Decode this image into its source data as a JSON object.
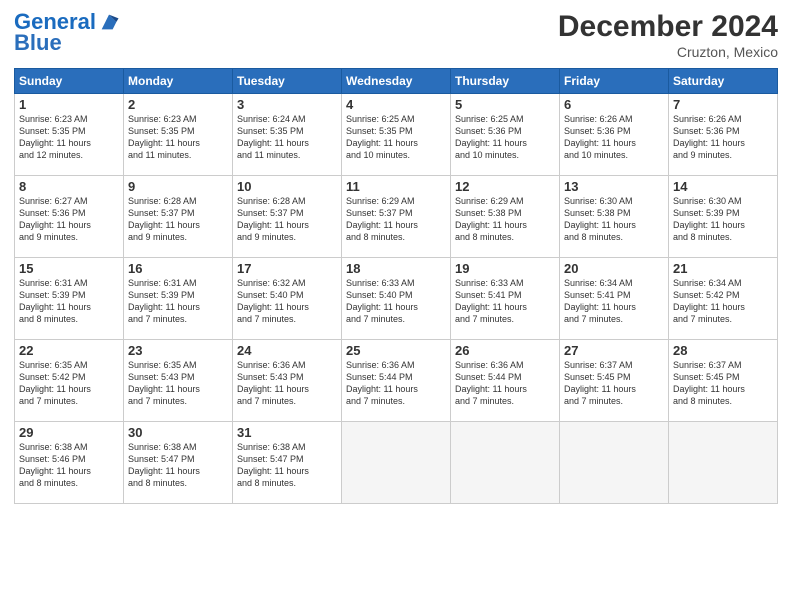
{
  "header": {
    "logo_line1": "General",
    "logo_line2": "Blue",
    "month": "December 2024",
    "location": "Cruzton, Mexico"
  },
  "weekdays": [
    "Sunday",
    "Monday",
    "Tuesday",
    "Wednesday",
    "Thursday",
    "Friday",
    "Saturday"
  ],
  "weeks": [
    [
      {
        "day": "1",
        "info": "Sunrise: 6:23 AM\nSunset: 5:35 PM\nDaylight: 11 hours\nand 12 minutes."
      },
      {
        "day": "2",
        "info": "Sunrise: 6:23 AM\nSunset: 5:35 PM\nDaylight: 11 hours\nand 11 minutes."
      },
      {
        "day": "3",
        "info": "Sunrise: 6:24 AM\nSunset: 5:35 PM\nDaylight: 11 hours\nand 11 minutes."
      },
      {
        "day": "4",
        "info": "Sunrise: 6:25 AM\nSunset: 5:35 PM\nDaylight: 11 hours\nand 10 minutes."
      },
      {
        "day": "5",
        "info": "Sunrise: 6:25 AM\nSunset: 5:36 PM\nDaylight: 11 hours\nand 10 minutes."
      },
      {
        "day": "6",
        "info": "Sunrise: 6:26 AM\nSunset: 5:36 PM\nDaylight: 11 hours\nand 10 minutes."
      },
      {
        "day": "7",
        "info": "Sunrise: 6:26 AM\nSunset: 5:36 PM\nDaylight: 11 hours\nand 9 minutes."
      }
    ],
    [
      {
        "day": "8",
        "info": "Sunrise: 6:27 AM\nSunset: 5:36 PM\nDaylight: 11 hours\nand 9 minutes."
      },
      {
        "day": "9",
        "info": "Sunrise: 6:28 AM\nSunset: 5:37 PM\nDaylight: 11 hours\nand 9 minutes."
      },
      {
        "day": "10",
        "info": "Sunrise: 6:28 AM\nSunset: 5:37 PM\nDaylight: 11 hours\nand 9 minutes."
      },
      {
        "day": "11",
        "info": "Sunrise: 6:29 AM\nSunset: 5:37 PM\nDaylight: 11 hours\nand 8 minutes."
      },
      {
        "day": "12",
        "info": "Sunrise: 6:29 AM\nSunset: 5:38 PM\nDaylight: 11 hours\nand 8 minutes."
      },
      {
        "day": "13",
        "info": "Sunrise: 6:30 AM\nSunset: 5:38 PM\nDaylight: 11 hours\nand 8 minutes."
      },
      {
        "day": "14",
        "info": "Sunrise: 6:30 AM\nSunset: 5:39 PM\nDaylight: 11 hours\nand 8 minutes."
      }
    ],
    [
      {
        "day": "15",
        "info": "Sunrise: 6:31 AM\nSunset: 5:39 PM\nDaylight: 11 hours\nand 8 minutes."
      },
      {
        "day": "16",
        "info": "Sunrise: 6:31 AM\nSunset: 5:39 PM\nDaylight: 11 hours\nand 7 minutes."
      },
      {
        "day": "17",
        "info": "Sunrise: 6:32 AM\nSunset: 5:40 PM\nDaylight: 11 hours\nand 7 minutes."
      },
      {
        "day": "18",
        "info": "Sunrise: 6:33 AM\nSunset: 5:40 PM\nDaylight: 11 hours\nand 7 minutes."
      },
      {
        "day": "19",
        "info": "Sunrise: 6:33 AM\nSunset: 5:41 PM\nDaylight: 11 hours\nand 7 minutes."
      },
      {
        "day": "20",
        "info": "Sunrise: 6:34 AM\nSunset: 5:41 PM\nDaylight: 11 hours\nand 7 minutes."
      },
      {
        "day": "21",
        "info": "Sunrise: 6:34 AM\nSunset: 5:42 PM\nDaylight: 11 hours\nand 7 minutes."
      }
    ],
    [
      {
        "day": "22",
        "info": "Sunrise: 6:35 AM\nSunset: 5:42 PM\nDaylight: 11 hours\nand 7 minutes."
      },
      {
        "day": "23",
        "info": "Sunrise: 6:35 AM\nSunset: 5:43 PM\nDaylight: 11 hours\nand 7 minutes."
      },
      {
        "day": "24",
        "info": "Sunrise: 6:36 AM\nSunset: 5:43 PM\nDaylight: 11 hours\nand 7 minutes."
      },
      {
        "day": "25",
        "info": "Sunrise: 6:36 AM\nSunset: 5:44 PM\nDaylight: 11 hours\nand 7 minutes."
      },
      {
        "day": "26",
        "info": "Sunrise: 6:36 AM\nSunset: 5:44 PM\nDaylight: 11 hours\nand 7 minutes."
      },
      {
        "day": "27",
        "info": "Sunrise: 6:37 AM\nSunset: 5:45 PM\nDaylight: 11 hours\nand 7 minutes."
      },
      {
        "day": "28",
        "info": "Sunrise: 6:37 AM\nSunset: 5:45 PM\nDaylight: 11 hours\nand 8 minutes."
      }
    ],
    [
      {
        "day": "29",
        "info": "Sunrise: 6:38 AM\nSunset: 5:46 PM\nDaylight: 11 hours\nand 8 minutes."
      },
      {
        "day": "30",
        "info": "Sunrise: 6:38 AM\nSunset: 5:47 PM\nDaylight: 11 hours\nand 8 minutes."
      },
      {
        "day": "31",
        "info": "Sunrise: 6:38 AM\nSunset: 5:47 PM\nDaylight: 11 hours\nand 8 minutes."
      },
      {
        "day": "",
        "info": ""
      },
      {
        "day": "",
        "info": ""
      },
      {
        "day": "",
        "info": ""
      },
      {
        "day": "",
        "info": ""
      }
    ]
  ]
}
